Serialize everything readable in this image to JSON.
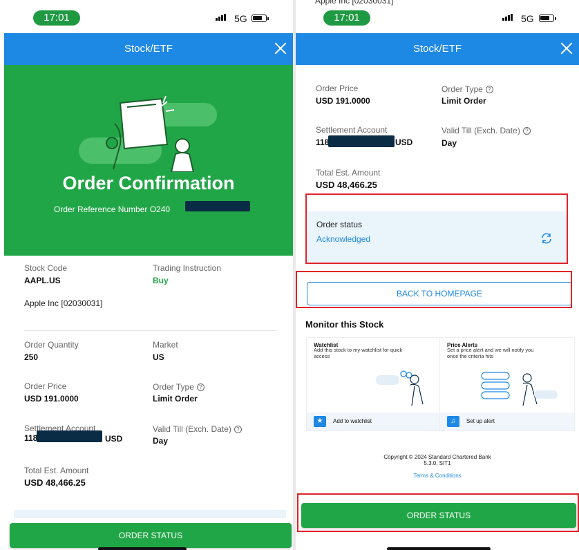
{
  "left": {
    "status_time": "17:01",
    "network": "5G",
    "header_title": "Stock/ETF",
    "hero_title": "Order Confirmation",
    "order_ref_label": "Order Reference Number O240",
    "stock_code_label": "Stock Code",
    "stock_code_value": "AAPL.US",
    "trading_instruction_label": "Trading Instruction",
    "trading_instruction_value": "Buy",
    "stock_name": "Apple Inc [02030031]",
    "order_quantity_label": "Order Quantity",
    "order_quantity_value": "250",
    "market_label": "Market",
    "market_value": "US",
    "order_price_label": "Order Price",
    "order_price_value": "USD 191.0000",
    "order_type_label": "Order Type",
    "order_type_value": "Limit Order",
    "settlement_label": "Settlement Account",
    "settlement_prefix": "118",
    "settlement_currency": "USD",
    "valid_till_label": "Valid Till (Exch. Date)",
    "valid_till_value": "Day",
    "total_label": "Total Est. Amount",
    "total_value": "USD 48,466.25",
    "order_status_button": "ORDER STATUS"
  },
  "right": {
    "top_cut_text": "Apple Inc [02030031]",
    "status_time": "17:01",
    "network": "5G",
    "header_title": "Stock/ETF",
    "order_price_label": "Order Price",
    "order_price_value": "USD 191.0000",
    "order_type_label": "Order Type",
    "order_type_value": "Limit Order",
    "settlement_label": "Settlement Account",
    "settlement_prefix": "118",
    "settlement_currency": "USD",
    "valid_till_label": "Valid Till (Exch. Date)",
    "valid_till_value": "Day",
    "total_label": "Total Est. Amount",
    "total_value": "USD 48,466.25",
    "order_status_label": "Order status",
    "order_status_value": "Acknowledged",
    "back_home_button": "BACK TO HOMEPAGE",
    "monitor_title": "Monitor this Stock",
    "watchlist": {
      "title": "Watchlist",
      "desc": "Add this stock to my watchlist for quick access",
      "action": "Add to watchlist"
    },
    "price_alerts": {
      "title": "Price Alerts",
      "desc": "Set a price alert and we will notify you once the criteria hits",
      "action": "Set up alert"
    },
    "copyright_line1": "Copyright © 2024 Standard Chartered Bank",
    "copyright_line2": "5.3.0, SIT1",
    "terms_link": "Terms & Conditions",
    "order_status_button": "ORDER STATUS"
  },
  "colors": {
    "brand_green": "#21a647",
    "header_blue": "#1e88e5",
    "highlight_red": "#e0232a",
    "status_box_bg": "#eaf4fb"
  }
}
